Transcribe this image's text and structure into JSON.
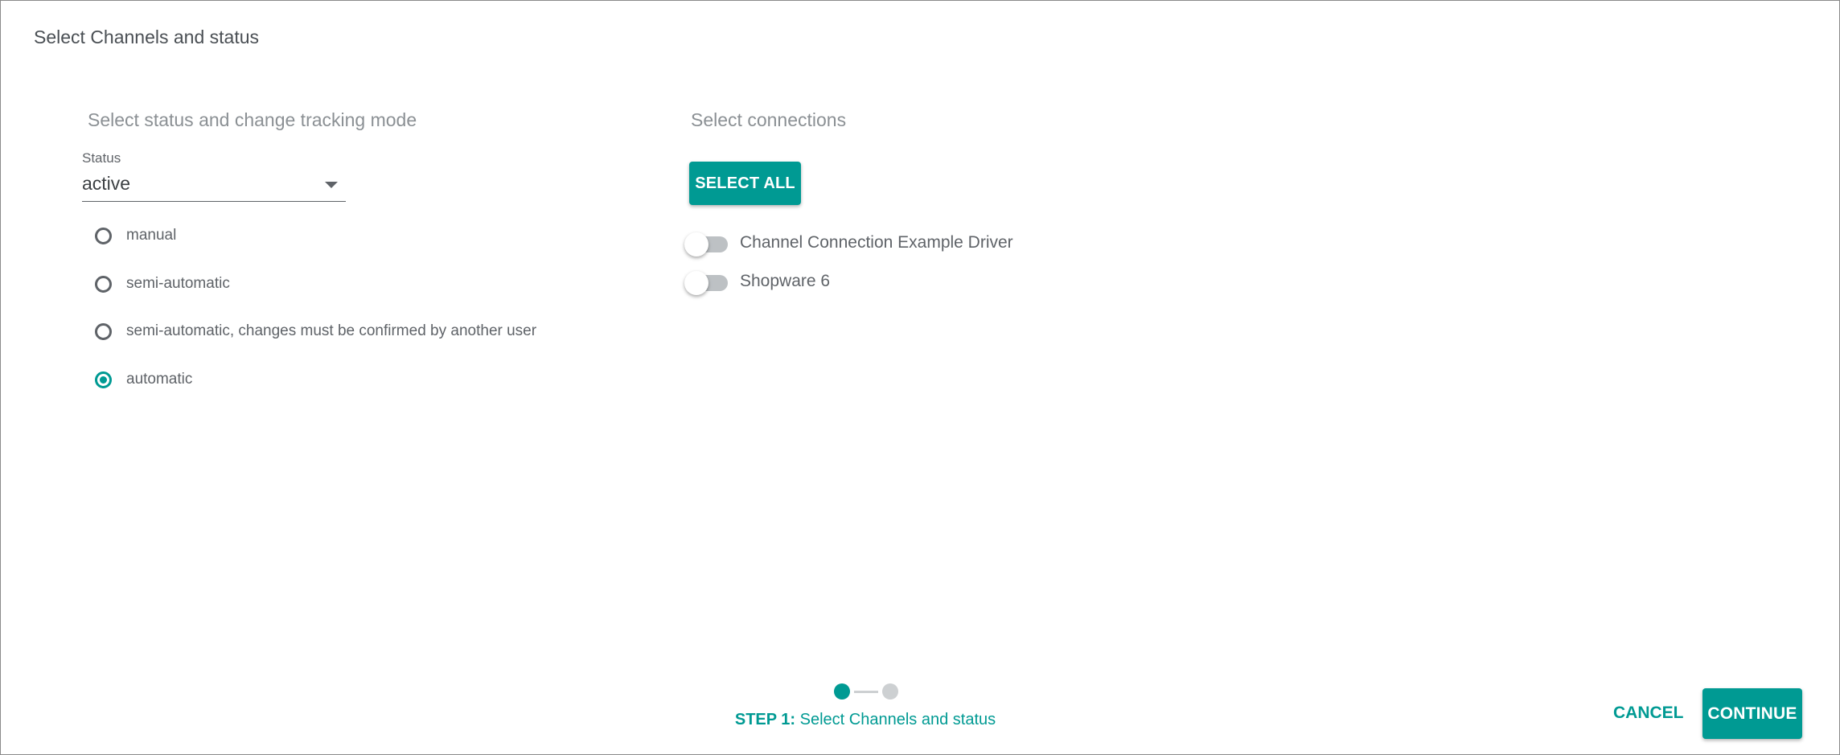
{
  "dialog": {
    "title": "Select Channels and status"
  },
  "left_section": {
    "heading": "Select status and change tracking mode",
    "status_field": {
      "label": "Status",
      "value": "active"
    },
    "tracking_modes": [
      {
        "label": "manual",
        "checked": false
      },
      {
        "label": "semi-automatic",
        "checked": false
      },
      {
        "label": "semi-automatic, changes must be confirmed by another user",
        "checked": false
      },
      {
        "label": "automatic",
        "checked": true
      }
    ]
  },
  "right_section": {
    "heading": "Select connections",
    "select_all_label": "SELECT ALL",
    "connections": [
      {
        "label": "Channel Connection Example Driver",
        "enabled": false
      },
      {
        "label": "Shopware 6",
        "enabled": false
      }
    ]
  },
  "stepper": {
    "current_step": 1,
    "total_steps": 2,
    "step_prefix": "STEP 1:",
    "step_title": "Select Channels and status"
  },
  "footer": {
    "cancel_label": "CANCEL",
    "continue_label": "CONTINUE"
  },
  "colors": {
    "accent": "#009a93",
    "text": "#5f6368",
    "heading": "#8b9094",
    "inactive": "#cdd0d2"
  }
}
